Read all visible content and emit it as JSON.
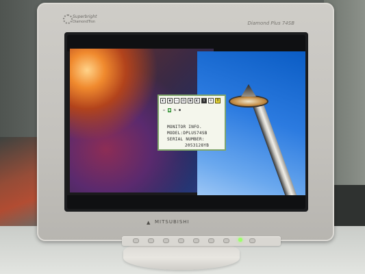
{
  "monitor": {
    "brand_logo_line1": "Superbright",
    "brand_logo_line2": "DiamondTron",
    "model_label": "Diamond Plus 74SB",
    "maker_label": "MITSUBISHI"
  },
  "osd": {
    "line1": "MONITOR INFO.",
    "line2": "MODEL:DPLUS74SB",
    "line3": "SERIAL NUMBER:",
    "line4": "2053128YB"
  },
  "screen_scene": {
    "subject": "space-needle-icon"
  },
  "colors": {
    "osd_border": "#7ea46a",
    "osd_background": "#f4f6ec",
    "power_led": "#9cff6a"
  }
}
